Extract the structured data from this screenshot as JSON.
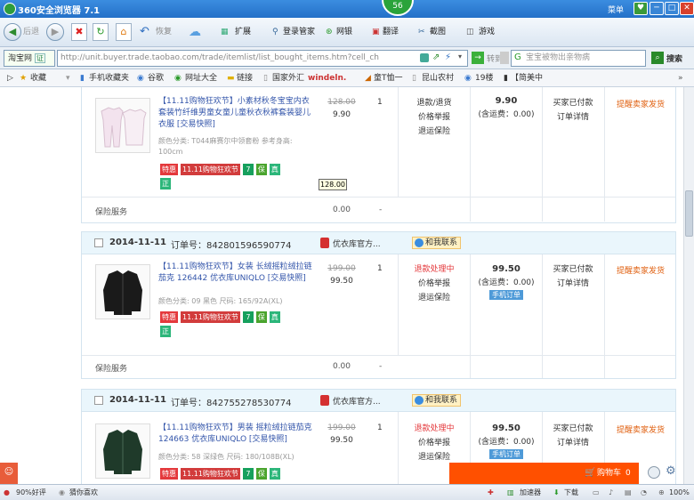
{
  "browser": {
    "title": "360安全浏览器 7.1",
    "badge": "56",
    "menu": "菜单",
    "win_min": "─",
    "win_max": "□",
    "win_close": "✕"
  },
  "toolbar": {
    "back": "后退",
    "restore": "恢复",
    "extend": "扩展",
    "login": "登录管家",
    "netbank": "网银",
    "translate": "翻译",
    "screenshot": "截图",
    "games": "游戏"
  },
  "address": {
    "site_tag": "淘宝网",
    "site_badge": "证",
    "url": "http://unit.buyer.trade.taobao.com/trade/itemlist/list_bought_items.htm?cell_ch",
    "go": "转到",
    "search_placeholder": "宝宝被物出亲物病",
    "search_button": "搜索"
  },
  "bookmarks": [
    "收藏",
    "手机收藏夹",
    "谷歌",
    "网址大全",
    "链接",
    "国家外汇",
    "windeln.",
    "童T恤一",
    "昆山农村",
    "19楼",
    "【简美中"
  ],
  "orders": [
    {
      "date": "",
      "order_no": "",
      "shop": "",
      "contact": "",
      "title": "【11.11购物狂欢节】小素材秋冬宝宝内衣套装竹纤维男童女童儿童秋衣秋裤套装婴儿衣服 [交易快照]",
      "attr": "颜色分类: T044麻赛尔中领套粉 参考身高: 100cm",
      "orig_price": "128.00",
      "price": "9.90",
      "qty": "1",
      "service": [
        "退款/退货",
        "价格举报",
        "退运保险"
      ],
      "total": "9.90",
      "shipping": "(含运费：0.00)",
      "mobile": "",
      "status": [
        "买家已付款",
        "订单详情"
      ],
      "remind": "提醒卖家发货",
      "insurance": "保险服务",
      "ins_price": "0.00",
      "ins_dash": "-"
    },
    {
      "date": "2014-11-11",
      "order_no": "订单号：842801596590774",
      "shop": "优衣库官方...",
      "contact": "和我联系",
      "title": "【11.11购物狂欢节】女装 长绒摇粒绒拉链茄克 126442 优衣库UNIQLO [交易快照]",
      "attr": "颜色分类: 09 黑色 尺码: 165/92A(XL)",
      "orig_price": "199.00",
      "price": "99.50",
      "qty": "1",
      "service": [
        "退款处理中",
        "价格举报",
        "退运保险"
      ],
      "total": "99.50",
      "shipping": "(含运费：0.00)",
      "mobile": "手机订单",
      "status": [
        "买家已付款",
        "订单详情"
      ],
      "remind": "提醒卖家发货",
      "insurance": "保险服务",
      "ins_price": "0.00",
      "ins_dash": "-"
    },
    {
      "date": "2014-11-11",
      "order_no": "订单号：842755278530774",
      "shop": "优衣库官方...",
      "contact": "和我联系",
      "title": "【11.11购物狂欢节】男装 摇粒绒拉链茄克 124663 优衣库UNIQLO [交易快照]",
      "attr": "颜色分类: 58 深绿色 尺码: 180/108B(XL)",
      "orig_price": "199.00",
      "price": "99.50",
      "qty": "1",
      "service": [
        "退款处理中",
        "价格举报",
        "退运保险"
      ],
      "total": "99.50",
      "shipping": "(含运费：0.00)",
      "mobile": "手机订单",
      "status": [
        "买家已付款",
        "订单详情"
      ],
      "remind": "提醒卖家发货"
    }
  ],
  "tags": {
    "sale": "特惠",
    "festival": "11.11购物狂欢节",
    "seven": "7",
    "guarantee": "保",
    "genuine": "真",
    "authentic": "正"
  },
  "tooltip": "128.00",
  "cart": {
    "label": "购物车",
    "count": "0"
  },
  "status_bar": {
    "rating": "90%好评",
    "guess": "猜你喜欢",
    "accelerator": "加速器",
    "download": "下载",
    "zoom": "100%"
  },
  "colors": {
    "accent": "#ff5000",
    "link": "#3355aa",
    "warn": "#e4393c"
  }
}
